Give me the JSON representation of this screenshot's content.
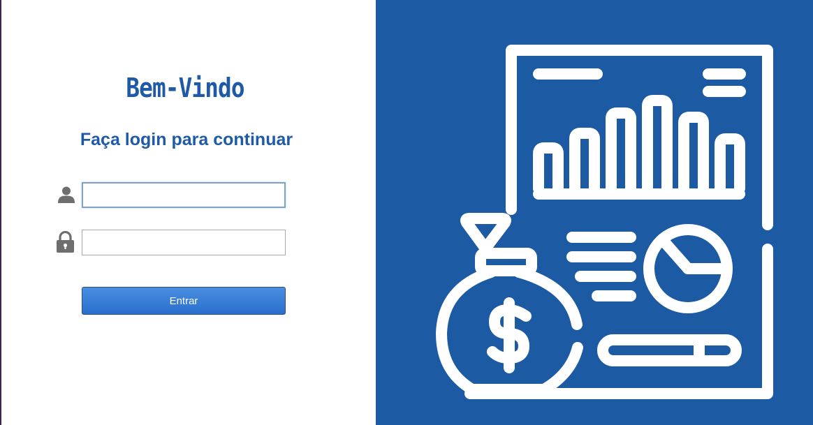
{
  "login": {
    "title": "Bem-Vindo",
    "subtitle": "Faça login para continuar",
    "username": {
      "value": "",
      "placeholder": "",
      "icon": "user-icon"
    },
    "password": {
      "value": "",
      "placeholder": "",
      "icon": "lock-icon"
    },
    "submit_label": "Entrar"
  },
  "illustration": {
    "icon": "financial-report-money-bag-icon"
  },
  "colors": {
    "brand_blue": "#1c5aa4",
    "title_blue": "#1f5aa6",
    "button_blue": "#2a6fcc",
    "icon_gray": "#6e6e6e"
  }
}
